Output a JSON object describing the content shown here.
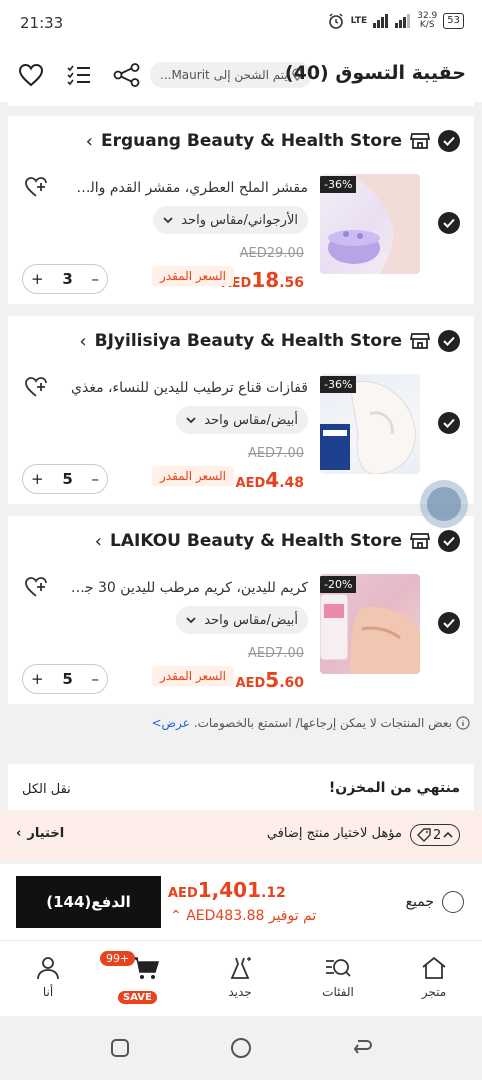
{
  "status": {
    "time": "21:33",
    "network": "LTE",
    "speed": "32.9",
    "speed_unit": "K/S",
    "battery": "53"
  },
  "header": {
    "title": "حقيبة التسوق (40)",
    "ship_to": "يتم الشحن إلى Maurit..."
  },
  "stores": [
    {
      "name": "Erguang Beauty & Health Store",
      "product_title": "مقشر الملح العطري، مقشر القدم والجسم",
      "variant": "الأرجواني/مقاس واحد",
      "discount": "-36%",
      "old_price": "AED29.00",
      "currency": "AED",
      "price_int": "18",
      "price_dec": ".56",
      "estimate_label": "السعر المقدر",
      "qty": "3"
    },
    {
      "name": "BJyilisiya Beauty & Health Store",
      "product_title": "قفازات قناع ترطيب لليدين للنساء، مغذي",
      "variant": "أبيض/مقاس واحد",
      "discount": "-36%",
      "old_price": "AED7.00",
      "currency": "AED",
      "price_int": "4",
      "price_dec": ".48",
      "estimate_label": "السعر المقدر",
      "qty": "5"
    },
    {
      "name": "LAIKOU Beauty & Health Store",
      "product_title": "كريم لليدين، كريم مرطب لليدين 30 جرام",
      "variant": "أبيض/مقاس واحد",
      "discount": "-20%",
      "old_price": "AED7.00",
      "currency": "AED",
      "price_int": "5",
      "price_dec": ".60",
      "estimate_label": "السعر المقدر",
      "qty": "5"
    }
  ],
  "notice": {
    "text": "بعض المنتجات لا يمكن إرجاعها/ استمتع بالخصومات.",
    "link": "عرض>"
  },
  "out_of_stock": {
    "title": "منتهي من المخزن!",
    "move_all": "نقل الكل"
  },
  "promo": {
    "tag_count": "2",
    "text": "مؤهل لاختيار منتج إضافي",
    "select": "اختيار"
  },
  "checkout": {
    "pay_label": "الدفع(144)",
    "currency": "AED",
    "total_int": "1,401",
    "total_dec": ".12",
    "saving": "تم توفير AED483.88",
    "select_all": "جميع"
  },
  "tabs": {
    "store": "متجر",
    "categories": "الفئات",
    "new": "جديد",
    "cart_badge": "99+",
    "save": "SAVE",
    "me": "أنا"
  },
  "colors": {
    "accent": "#e6431e",
    "dark": "#111111",
    "promo_bg": "#fdeee9",
    "link": "#1a6ad0"
  }
}
